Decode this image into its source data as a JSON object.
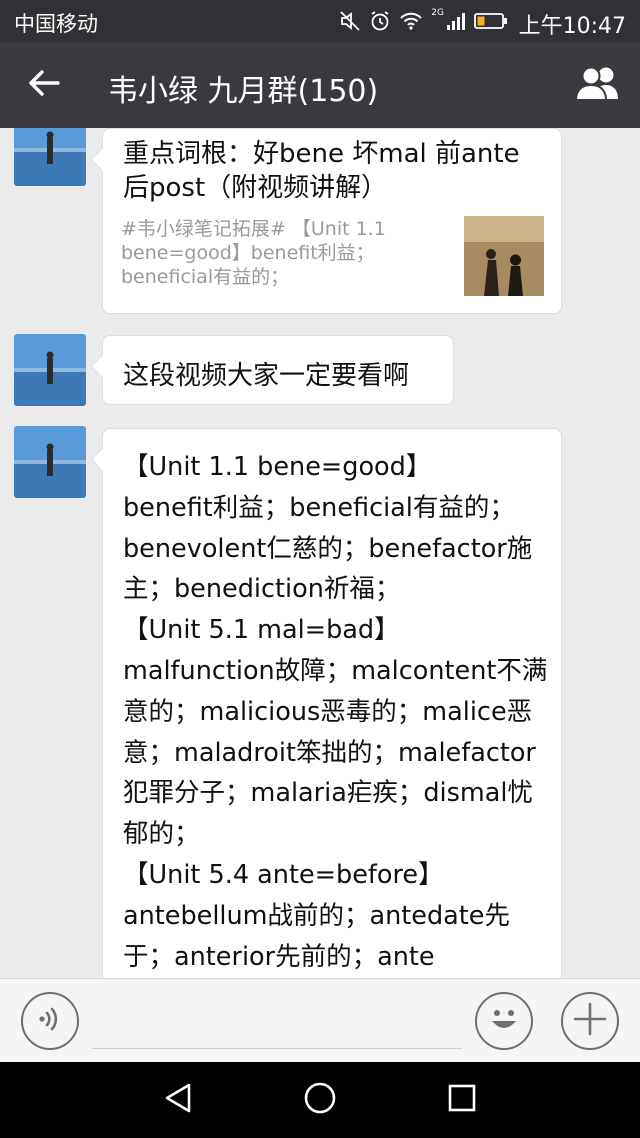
{
  "status_bar": {
    "carrier": "中国移动",
    "network_tag": "2G",
    "time": "上午10:47"
  },
  "title_bar": {
    "title": "韦小绿  九月群(150)"
  },
  "messages": {
    "card": {
      "title": "重点词根：好bene 坏mal 前ante 后post（附视频讲解）",
      "description": "#韦小绿笔记拓展# 【Unit 1.1 bene=good】benefit利益；beneficial有益的；"
    },
    "text_message": "这段视频大家一定要看啊",
    "long_message": {
      "lines": [
        "【Unit 1.1 bene=good】",
        "benefit利益；beneficial有益的；",
        "benevolent仁慈的；benefactor施",
        "主；benediction祈福；",
        "【Unit 5.1 mal=bad】",
        "malfunction故障；malcontent不满",
        "意的；malicious恶毒的；malice恶",
        "意；maladroit笨拙的；malefactor",
        "犯罪分子；malaria疟疾；dismal忧",
        "郁的；",
        "【Unit 5.4 ante=before】",
        "antebellum战前的；antedate先",
        "于；anterior先前的；ante",
        "…"
      ]
    }
  },
  "colors": {
    "status_bar_bg": "#2f3134",
    "title_bar_bg": "#393a3f",
    "chat_bg": "#ebebeb",
    "bubble_bg": "#ffffff",
    "input_bar_bg": "#f5f5f7",
    "nav_bar_bg": "#000000"
  },
  "icons": {
    "back": "arrow-left-icon",
    "group": "group-members-icon",
    "voice": "voice-icon",
    "emoji": "emoji-icon",
    "plus": "plus-icon"
  }
}
